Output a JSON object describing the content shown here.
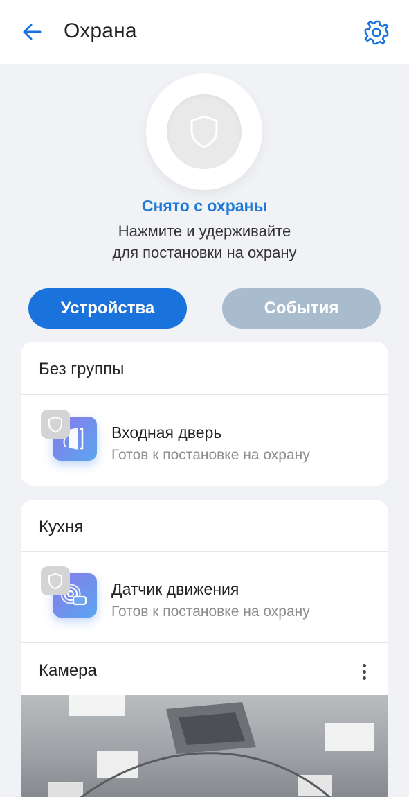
{
  "header": {
    "title": "Охрана",
    "back_icon": "arrow-left-icon",
    "settings_icon": "gear-icon"
  },
  "arm": {
    "icon": "shield-icon",
    "status": "Снято с охраны",
    "hint_line1": "Нажмите и удерживайте",
    "hint_line2": "для постановки на охрану"
  },
  "tabs": [
    {
      "label": "Устройства",
      "active": true
    },
    {
      "label": "События",
      "active": false
    }
  ],
  "groups": [
    {
      "title": "Без группы",
      "devices": [
        {
          "name": "Входная дверь",
          "status": "Готов к постановке на охрану",
          "icon": "door-sensor-icon"
        }
      ]
    },
    {
      "title": "Кухня",
      "devices": [
        {
          "name": "Датчик движения",
          "status": "Готов к постановке на охрану",
          "icon": "motion-sensor-icon"
        }
      ],
      "camera": {
        "title": "Камера",
        "more_icon": "more-vertical-icon"
      }
    }
  ],
  "colors": {
    "accent": "#1a72dd",
    "status_text": "#1e7ad6",
    "inactive_tab": "#a9bccd",
    "background": "#f0f2f5"
  }
}
